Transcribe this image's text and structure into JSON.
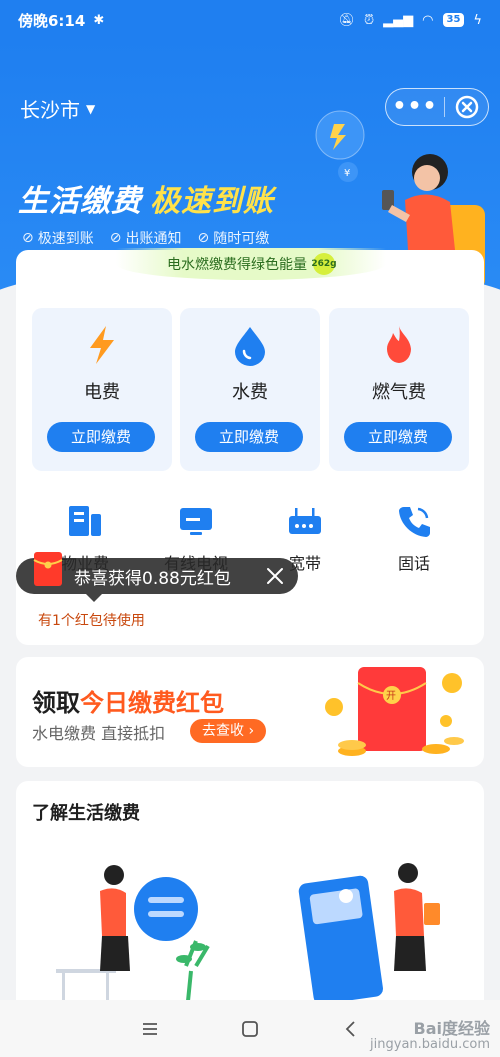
{
  "status_bar": {
    "time": "傍晚6:14",
    "battery": "35"
  },
  "header": {
    "city": "长沙市"
  },
  "hero": {
    "title_main": "生活缴费",
    "title_accent": "极速到账",
    "tags": [
      "极速到账",
      "出账通知",
      "随时可缴"
    ]
  },
  "main": {
    "green_banner": "电水燃缴费得绿色能量",
    "green_badge": "262g",
    "fees": [
      {
        "label": "电费",
        "button": "立即缴费",
        "icon": "lightning-icon"
      },
      {
        "label": "水费",
        "button": "立即缴费",
        "icon": "water-drop-icon"
      },
      {
        "label": "燃气费",
        "button": "立即缴费",
        "icon": "flame-icon"
      }
    ],
    "sub_items": [
      {
        "label": "物业费",
        "icon": "property-icon"
      },
      {
        "label": "有线电视",
        "icon": "tv-icon"
      },
      {
        "label": "宽带",
        "icon": "router-icon"
      },
      {
        "label": "固话",
        "icon": "phone-icon"
      }
    ],
    "toast": "恭喜获得0.88元红包",
    "pending": "有1个红包待使用"
  },
  "promo": {
    "title_prefix": "领取",
    "title_highlight": "今日缴费红包",
    "subtitle": "水电缴费 直接抵扣",
    "button": "去查收"
  },
  "learn": {
    "title": "了解生活缴费"
  },
  "watermark": {
    "line1": "Bai度经验",
    "line2": "jingyan.baidu.com"
  },
  "colors": {
    "primary": "#1f7ff0",
    "accent": "#ff6a23",
    "electric": "#ff9a1f",
    "water": "#1f7ff0",
    "gas": "#ff4a3a"
  }
}
